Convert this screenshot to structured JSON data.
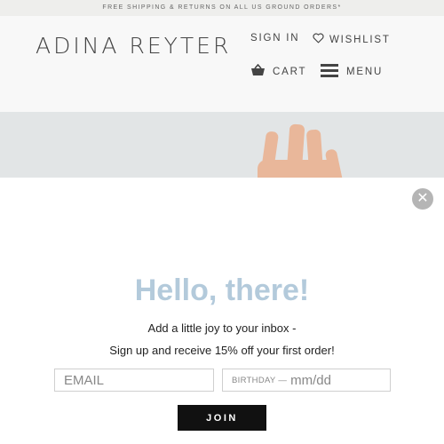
{
  "announcement": "FREE SHIPPING & RETURNS ON ALL US GROUND ORDERS*",
  "header": {
    "logo": "ADINA REYTER",
    "sign_in": "SIGN IN",
    "wishlist": "WISHLIST",
    "cart": "CART",
    "menu": "MENU"
  },
  "popup": {
    "heading": "Hello, there!",
    "line1": "Add a little joy to your inbox -",
    "line2": "Sign up and receive 15% off your first order!",
    "email_placeholder": "EMAIL",
    "birthday_label": "BIRTHDAY —",
    "birthday_placeholder": "mm/dd",
    "join_label": "JOIN",
    "close_symbol": "✕"
  },
  "colors": {
    "heading": "#b3cadb",
    "join_bg": "#111111",
    "hero_bg": "#e2e5e6"
  }
}
